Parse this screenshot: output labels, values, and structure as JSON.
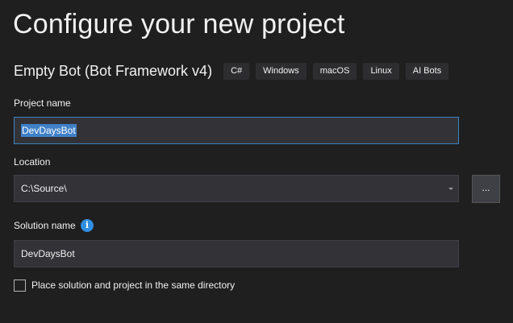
{
  "header": {
    "title": "Configure your new project"
  },
  "template": {
    "name": "Empty Bot (Bot Framework v4)",
    "tags": [
      "C#",
      "Windows",
      "macOS",
      "Linux",
      "AI Bots"
    ]
  },
  "project_name": {
    "label": "Project name",
    "value": "DevDaysBot"
  },
  "location": {
    "label": "Location",
    "value": "C:\\Source\\",
    "browse_label": "..."
  },
  "solution_name": {
    "label": "Solution name",
    "value": "DevDaysBot",
    "info_glyph": "i"
  },
  "same_directory": {
    "label": "Place solution and project in the same directory",
    "checked": false
  }
}
